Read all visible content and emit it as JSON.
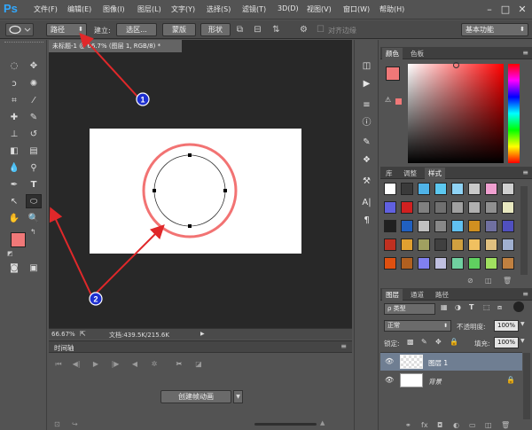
{
  "app": {
    "logo": "Ps"
  },
  "menu": [
    "文件(F)",
    "编辑(E)",
    "图像(I)",
    "图层(L)",
    "文字(Y)",
    "选择(S)",
    "滤镜(T)",
    "3D(D)",
    "视图(V)",
    "窗口(W)",
    "帮助(H)"
  ],
  "window_controls": {
    "minimize": "–",
    "restore": "□",
    "close": "✕"
  },
  "options": {
    "mode_value": "路径",
    "make_label": "建立:",
    "selection_btn": "选区...",
    "mask_btn": "蒙版",
    "shape_btn": "形状",
    "align_edges": "对齐边缘",
    "workspace": "基本功能"
  },
  "document": {
    "tab_title": "未标题-1 @ 66.7% (图层 1, RGB/8) *",
    "zoom": "66.67%",
    "doc_info": "文档:439.5K/215.6K"
  },
  "timeline": {
    "title": "时间轴",
    "create_button": "创建帧动画"
  },
  "panels": {
    "color_tabs": [
      "颜色",
      "色板"
    ],
    "adjust_tabs": [
      "库",
      "调整",
      "样式"
    ],
    "layers_tabs": [
      "图层",
      "通道",
      "路径"
    ]
  },
  "layers": {
    "filter_kind": "ρ 类型",
    "blend_mode": "正常",
    "opacity_label": "不透明度:",
    "opacity_value": "100%",
    "lock_label": "锁定:",
    "fill_label": "填充:",
    "fill_value": "100%",
    "items": [
      {
        "name": "图层 1",
        "selected": true
      },
      {
        "name": "背景",
        "selected": false
      }
    ]
  },
  "annotations": {
    "label_1": "1",
    "label_2": "2"
  },
  "colors": {
    "foreground": "#f07878",
    "background": "#000000",
    "annotation_arrow": "#e0282a",
    "annotation_badge": "#1d2fd0",
    "selected_layer": "#6f7e92",
    "ring": "#f05a5a"
  }
}
